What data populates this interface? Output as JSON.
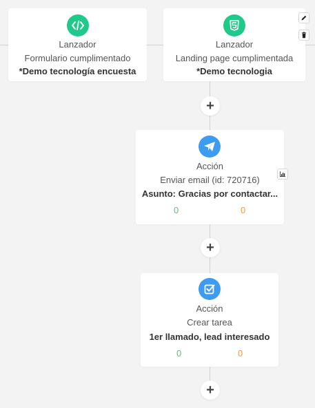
{
  "colors": {
    "trigger_icon_bg": "#1ec98a",
    "action_icon_bg": "#3e9bf2",
    "success": "#4ec46f",
    "failure": "#f39545"
  },
  "triggers": [
    {
      "icon": "code-icon",
      "type": "Lanzador",
      "subtitle": "Formulario cumplimentado",
      "detail": "*Demo tecnología encuesta"
    },
    {
      "icon": "html5-icon",
      "type": "Lanzador",
      "subtitle": "Landing page cumplimentada",
      "detail": "*Demo tecnologia"
    }
  ],
  "actions": [
    {
      "icon": "paper-plane-icon",
      "type": "Acción",
      "subtitle": "Enviar email (id: 720716)",
      "detail": "Asunto: Gracias por contactar...",
      "success": "0",
      "failure": "0"
    },
    {
      "icon": "checkbox-icon",
      "type": "Acción",
      "subtitle": "Crear tarea",
      "detail": "1er llamado, lead interesado",
      "success": "0",
      "failure": "0"
    }
  ],
  "add_step_label": "+"
}
